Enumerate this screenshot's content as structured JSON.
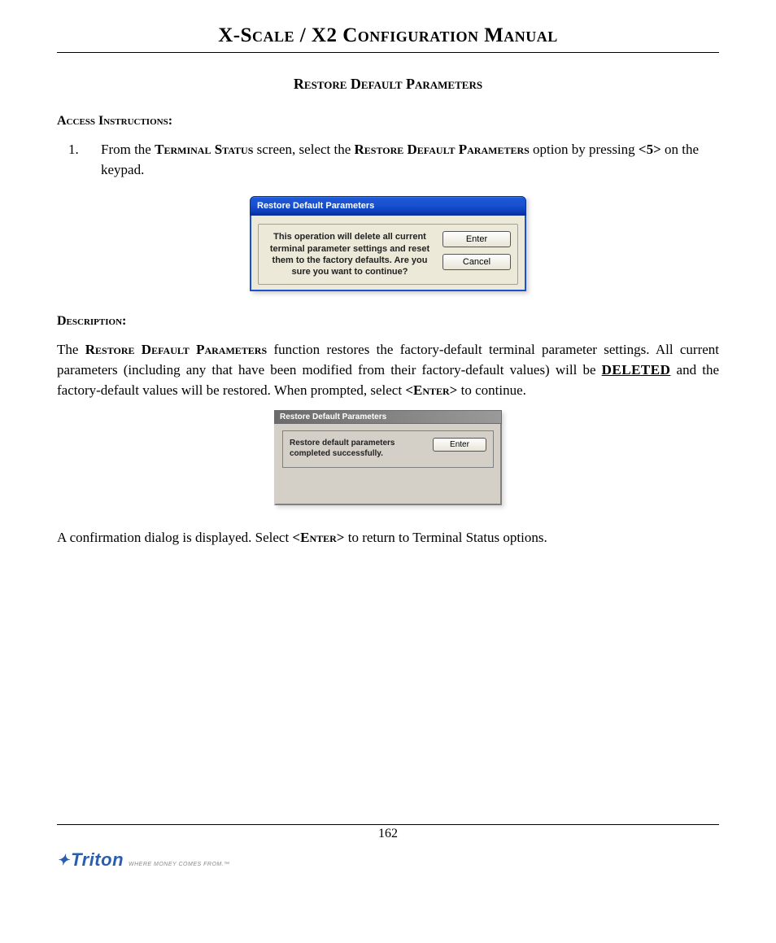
{
  "header": {
    "title": "X-Scale / X2 Configuration Manual"
  },
  "section": {
    "title": "Restore Default Parameters"
  },
  "access": {
    "heading": "Access Instructions:",
    "step_num": "1.",
    "step_pre": "From the ",
    "step_t1": "Terminal Status",
    "step_mid": " screen, select the ",
    "step_t2": "Restore Default Parameters",
    "step_post1": " option by pressing  ",
    "step_key": "<5>",
    "step_post2": " on the keypad."
  },
  "dialog1": {
    "title": "Restore Default Parameters",
    "message": "This operation will delete all current terminal parameter settings and reset them to the factory defaults. Are you sure you want to continue?",
    "btn_enter": "Enter",
    "btn_cancel": "Cancel"
  },
  "description": {
    "heading": "Description:",
    "p1_pre": "The ",
    "p1_t1": "Restore Default Parameters",
    "p1_mid": " function restores the factory-default terminal parameter settings.  All current parameters (including any that have been modified from their factory-default values) will be ",
    "p1_del": "DE­LETED",
    "p1_post1": " and the factory-default values will be restored.  When prompted, select ",
    "p1_key": "<Enter>",
    "p1_post2": " to continue."
  },
  "dialog2": {
    "title": "Restore Default Parameters",
    "message": "Restore default parameters completed successfully.",
    "btn_enter": "Enter"
  },
  "confirm": {
    "pre": "A confirmation dialog is displayed. Select ",
    "key": "<Enter>",
    "post": " to return to Terminal Status options."
  },
  "footer": {
    "page": "162",
    "logo_text": "Triton",
    "logo_tag": "WHERE MONEY COMES FROM.™"
  }
}
